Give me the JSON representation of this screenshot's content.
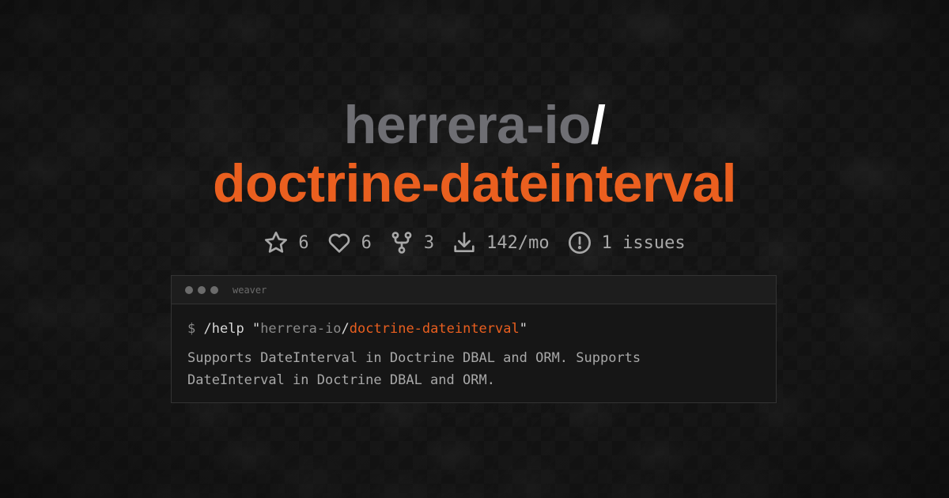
{
  "header": {
    "owner": "herrera-io",
    "slash": "/",
    "repo": "doctrine-dateinterval"
  },
  "stats": {
    "stars": "6",
    "likes": "6",
    "forks": "3",
    "downloads": "142/mo",
    "issues": "1 issues"
  },
  "icons": [
    "star-icon",
    "heart-icon",
    "fork-icon",
    "download-icon",
    "alert-icon"
  ],
  "terminal": {
    "title": "weaver",
    "prompt": "$",
    "command": "/help",
    "arg_quote_open": "\"",
    "arg_owner": "herrera-io",
    "arg_slash": "/",
    "arg_repo": "doctrine-dateinterval",
    "arg_quote_close": "\"",
    "description": "Supports DateInterval in Doctrine DBAL and ORM. Supports DateInterval in Doctrine DBAL and ORM."
  },
  "colors": {
    "accent": "#ea5f1f",
    "owner": "#6e6e73",
    "background": "#141414"
  }
}
